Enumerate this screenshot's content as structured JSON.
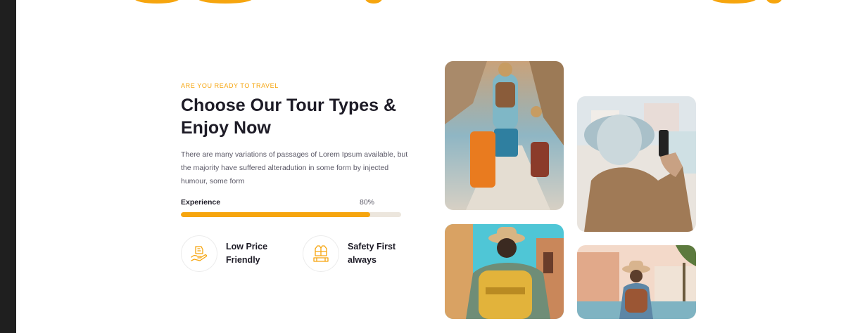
{
  "section": {
    "eyebrow": "ARE YOU READY TO TRAVEL",
    "title": "Choose Our Tour Types & Enjoy Now",
    "description": "There are many variations of passages of Lorem Ipsum available, but the majority have suffered alteradution in some form by injected humour,  some form"
  },
  "progress": {
    "label": "Experience",
    "value_text": "80%",
    "fill_fraction": 0.86
  },
  "features": [
    {
      "label": "Low Price Friendly",
      "icon": "hand-price-icon"
    },
    {
      "label": "Safety First always",
      "icon": "safety-vest-icon"
    }
  ],
  "gallery": [
    {
      "name": "photo-traveler-suitcases",
      "subject": "traveler-with-suitcases"
    },
    {
      "name": "photo-woman-taking-photo",
      "subject": "woman-taking-photo"
    },
    {
      "name": "photo-man-with-backpack",
      "subject": "man-with-backpack"
    },
    {
      "name": "photo-woman-by-canal",
      "subject": "woman-by-canal"
    }
  ],
  "colors": {
    "accent": "#f6a50e",
    "heading": "#1d1b26",
    "body_text": "#5a5866",
    "track": "#ece6dd"
  }
}
